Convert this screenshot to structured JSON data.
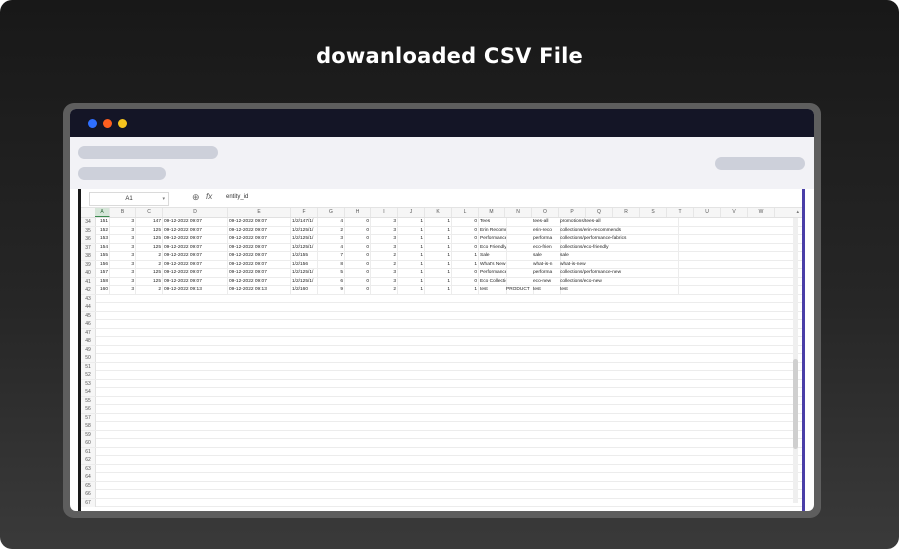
{
  "headline": "dowanloaded CSV File",
  "spreadsheet": {
    "name_box": "A1",
    "formula_value": "entity_id",
    "column_headers": [
      "A",
      "B",
      "C",
      "D",
      "E",
      "F",
      "G",
      "H",
      "I",
      "J",
      "K",
      "L",
      "M",
      "N",
      "O",
      "P",
      "Q",
      "R",
      "S",
      "T",
      "U",
      "V",
      "W"
    ],
    "rows": [
      {
        "n": "34",
        "c": [
          "151",
          "3",
          "147",
          "09-12-2022 09:07",
          "09-12-2022 09:07",
          "1/2/147/1/",
          "4",
          "0",
          "3",
          "1",
          "1",
          "0",
          "Tees",
          "",
          "tees-all",
          "promotions/tees-all"
        ]
      },
      {
        "n": "35",
        "c": [
          "152",
          "3",
          "125",
          "09-12-2022 09:07",
          "09-12-2022 09:07",
          "1/2/125/1/",
          "2",
          "0",
          "3",
          "1",
          "1",
          "0",
          "Erin Recommends",
          "",
          "erin-reco",
          "collections/erin-recommends"
        ]
      },
      {
        "n": "36",
        "c": [
          "153",
          "3",
          "125",
          "09-12-2022 09:07",
          "09-12-2022 09:07",
          "1/2/125/1/",
          "3",
          "0",
          "3",
          "1",
          "1",
          "0",
          "Performance Fabric",
          "",
          "performa",
          "collections/performance-fabrics"
        ]
      },
      {
        "n": "37",
        "c": [
          "154",
          "3",
          "125",
          "09-12-2022 09:07",
          "09-12-2022 09:07",
          "1/2/125/1/",
          "4",
          "0",
          "3",
          "1",
          "1",
          "0",
          "Eco Friendly",
          "",
          "eco-frien",
          "collections/eco-friendly"
        ]
      },
      {
        "n": "38",
        "c": [
          "155",
          "3",
          "2",
          "09-12-2022 09:07",
          "09-12-2022 09:07",
          "1/2/155",
          "7",
          "0",
          "2",
          "1",
          "1",
          "1",
          "Sale",
          "",
          "sale",
          "sale"
        ]
      },
      {
        "n": "39",
        "c": [
          "156",
          "3",
          "2",
          "09-12-2022 09:07",
          "09-12-2022 09:07",
          "1/2/156",
          "8",
          "0",
          "2",
          "1",
          "1",
          "1",
          "What's New",
          "",
          "what-is-n",
          "what-is-new"
        ]
      },
      {
        "n": "40",
        "c": [
          "157",
          "3",
          "125",
          "09-12-2022 09:07",
          "09-12-2022 09:07",
          "1/2/125/1/",
          "5",
          "0",
          "3",
          "1",
          "1",
          "0",
          "Performance Sport",
          "",
          "performa",
          "collections/performance-new"
        ]
      },
      {
        "n": "41",
        "c": [
          "158",
          "3",
          "125",
          "09-12-2022 09:07",
          "09-12-2022 09:07",
          "1/2/125/1/",
          "6",
          "0",
          "3",
          "1",
          "1",
          "0",
          "Eco Collection New",
          "",
          "eco-new",
          "collections/eco-new"
        ]
      },
      {
        "n": "42",
        "c": [
          "160",
          "3",
          "2",
          "09-12-2022 09:13",
          "09-12-2022 09:13",
          "1/2/160",
          "9",
          "0",
          "2",
          "1",
          "1",
          "1",
          "test",
          "PRODUCT",
          "test",
          "test"
        ]
      }
    ],
    "empty_row_numbers": [
      "43",
      "44",
      "45",
      "46",
      "47",
      "48",
      "49",
      "50",
      "51",
      "52",
      "53",
      "54",
      "55",
      "56",
      "57",
      "58",
      "59",
      "60",
      "61",
      "62",
      "63",
      "64",
      "65",
      "66",
      "67"
    ]
  }
}
